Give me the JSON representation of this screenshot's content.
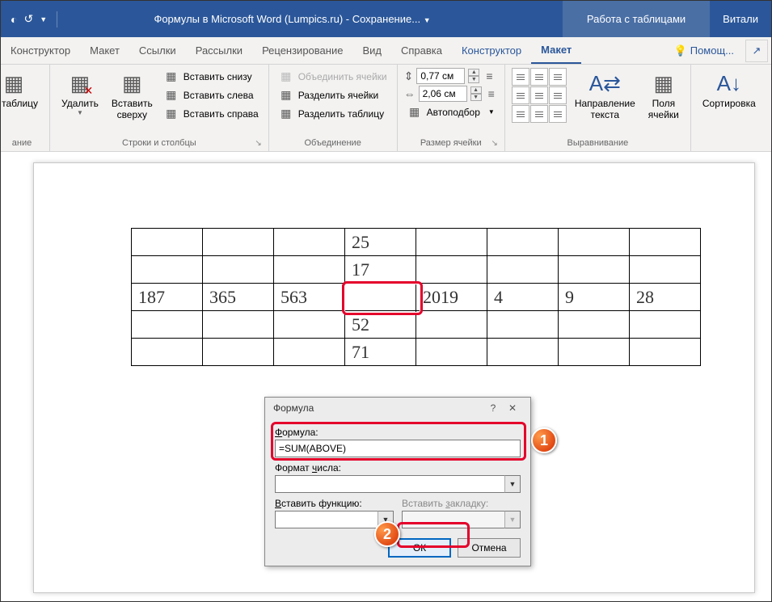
{
  "title_bar": {
    "doc_title": "Формулы в Microsoft Word (Lumpics.ru) - Сохранение...",
    "context_tab": "Работа с таблицами",
    "user": "Витали"
  },
  "tabs": {
    "constructor": "Конструктор",
    "layout": "Макет",
    "references": "Ссылки",
    "mailings": "Рассылки",
    "review": "Рецензирование",
    "view": "Вид",
    "help": "Справка",
    "design_ctx": "Конструктор",
    "layout_ctx": "Макет",
    "tell_me": "Помощ..."
  },
  "ribbon": {
    "draw_table_label": "ть таблицу",
    "draw_group": "ание",
    "delete": "Удалить",
    "insert_above": "Вставить\nсверху",
    "insert_below": "Вставить снизу",
    "insert_left": "Вставить слева",
    "insert_right": "Вставить справа",
    "rows_cols_group": "Строки и столбцы",
    "merge_cells": "Объединить ячейки",
    "split_cells": "Разделить ячейки",
    "split_table": "Разделить таблицу",
    "merge_group": "Объединение",
    "height_val": "0,77 см",
    "width_val": "2,06 см",
    "autofit": "Автоподбор",
    "cell_size_group": "Размер ячейки",
    "text_direction": "Направление\nтекста",
    "cell_margins": "Поля\nячейки",
    "alignment_group": "Выравнивание",
    "sort": "Сортировка"
  },
  "table": {
    "r0": [
      "",
      "",
      "",
      "25",
      "",
      "",
      "",
      ""
    ],
    "r1": [
      "",
      "",
      "",
      "17",
      "",
      "",
      "",
      ""
    ],
    "r2": [
      "187",
      "365",
      "563",
      "",
      "2019",
      "4",
      "9",
      "28"
    ],
    "r3": [
      "",
      "",
      "",
      "52",
      "",
      "",
      "",
      ""
    ],
    "r4": [
      "",
      "",
      "",
      "71",
      "",
      "",
      "",
      ""
    ]
  },
  "dialog": {
    "title": "Формула",
    "formula_label": "Формула:",
    "formula_value": "=SUM(ABOVE)",
    "format_label": "Формат числа:",
    "format_value": "",
    "insert_func_label": "Вставить функцию:",
    "insert_bookmark_label": "Вставить закладку:",
    "ok": "ОК",
    "cancel": "Отмена"
  },
  "callouts": {
    "one": "1",
    "two": "2"
  }
}
